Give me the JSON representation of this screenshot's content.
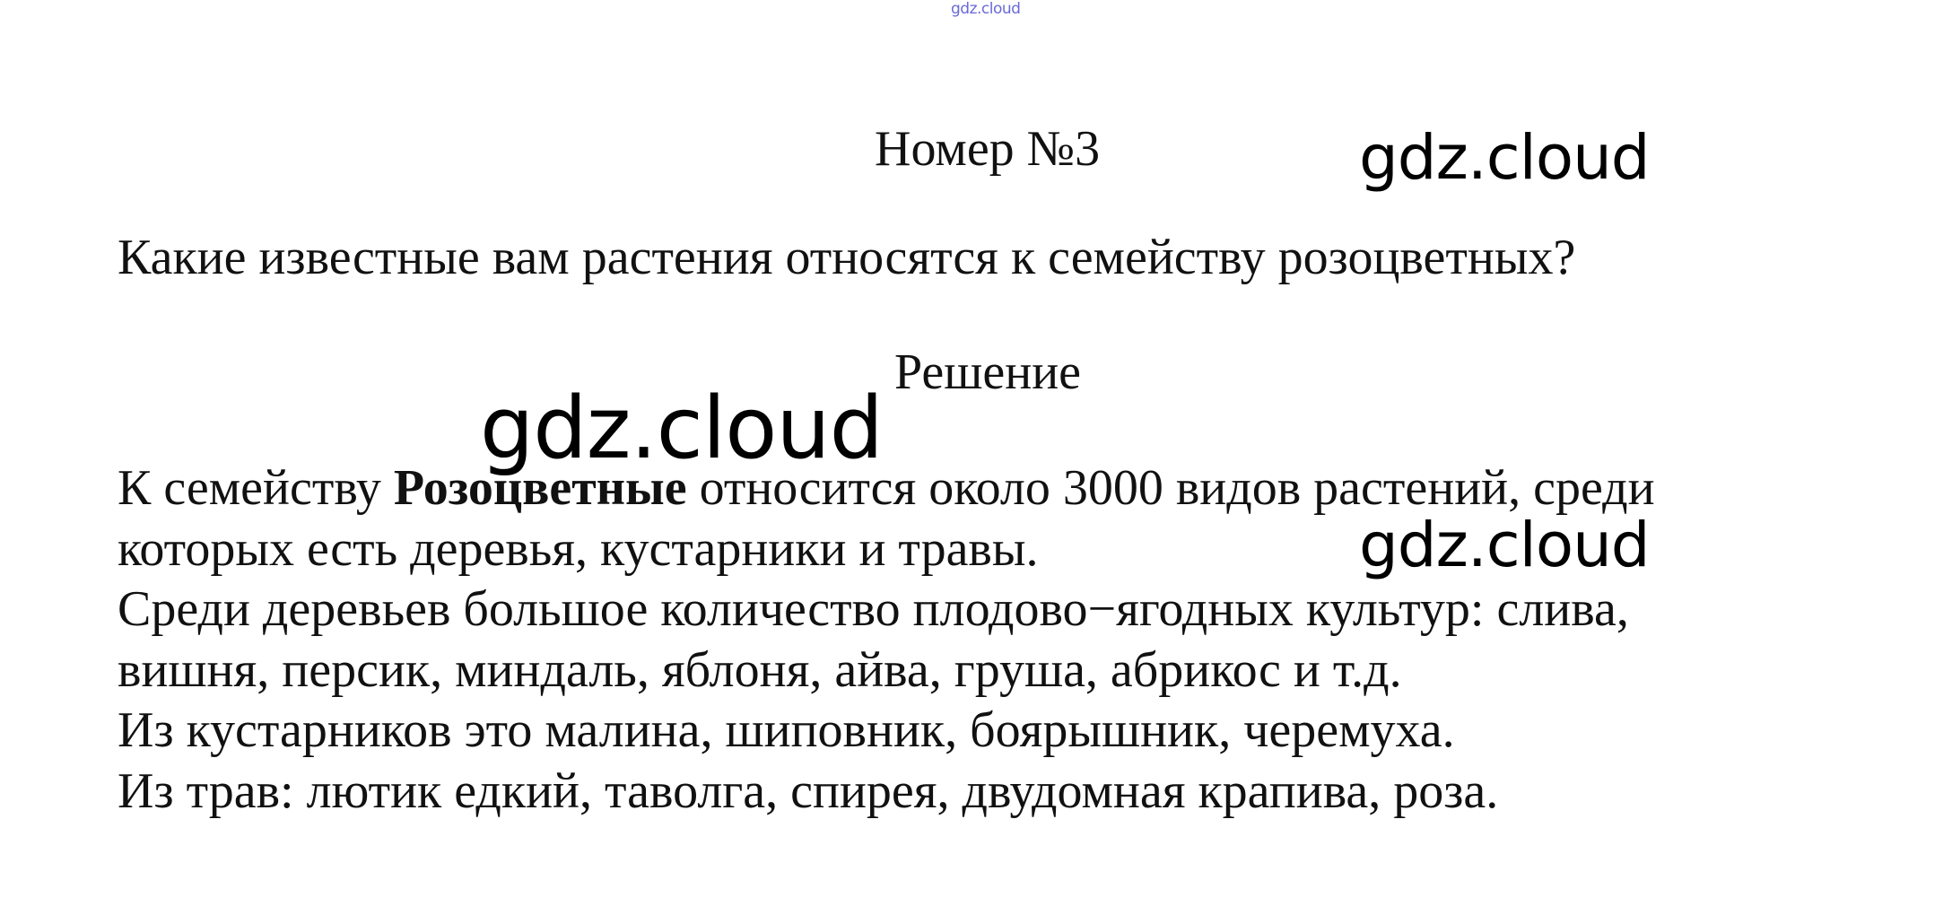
{
  "header": {
    "top_watermark": "gdz.cloud"
  },
  "task": {
    "title": "Номер №3",
    "question": "Какие известные вам растения относятся к семейству розоцветных?"
  },
  "solution": {
    "heading": "Решение",
    "paragraph1": {
      "before_bold": "К семейству ",
      "bold": "Розоцветные",
      "after_bold": " относится около 3000 видов растений, среди",
      "line2": "которых есть деревья, кустарники и травы."
    },
    "paragraph2": {
      "line1": "Среди деревьев большое количество плодово−ягодных культур: слива,",
      "line2": "вишня, персик, миндаль, яблоня, айва, груша, абрикос и т.д."
    },
    "paragraph3": "Из кустарников это малина, шиповник, боярышник, черемуха.",
    "paragraph4": "Из трав: лютик едкий, таволга, спирея, двудомная крапива, роза."
  },
  "watermarks": {
    "wm1": "gdz.cloud",
    "wm2": "gdz.cloud",
    "wm3": "gdz.cloud"
  }
}
